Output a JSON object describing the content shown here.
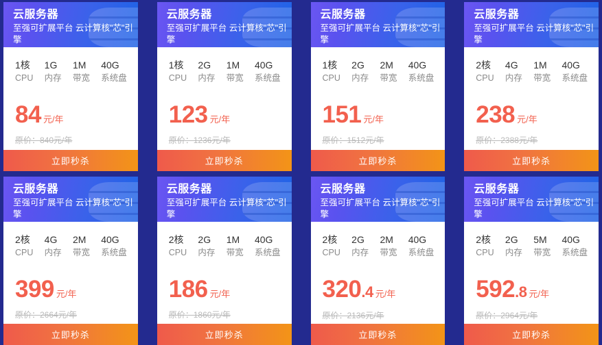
{
  "theme": {
    "page_background": "#232a8f",
    "header_gradient_from": "#6a56f2",
    "header_gradient_to": "#1f63e6",
    "price_color": "#f2604e",
    "button_gradient_from": "#ef5a4b",
    "button_gradient_to": "#f39417"
  },
  "common": {
    "title": "云服务器",
    "subtitle": "至强可扩展平台 云计算核\"芯\"引擎",
    "buy_label": "立即秒杀",
    "spec_labels": [
      "CPU",
      "内存",
      "带宽",
      "系统盘"
    ]
  },
  "cards": [
    {
      "title": "云服务器",
      "subtitle": "至强可扩展平台 云计算核\"芯\"引擎",
      "specs": [
        {
          "value": "1核",
          "label": "CPU"
        },
        {
          "value": "1G",
          "label": "内存"
        },
        {
          "value": "1M",
          "label": "带宽"
        },
        {
          "value": "40G",
          "label": "系统盘"
        }
      ],
      "price_main": "84",
      "price_dec": "",
      "price_unit": "元/年",
      "orig_price": "原价：840元/年",
      "buy_label": "立即秒杀"
    },
    {
      "title": "云服务器",
      "subtitle": "至强可扩展平台 云计算核\"芯\"引擎",
      "specs": [
        {
          "value": "1核",
          "label": "CPU"
        },
        {
          "value": "2G",
          "label": "内存"
        },
        {
          "value": "1M",
          "label": "带宽"
        },
        {
          "value": "40G",
          "label": "系统盘"
        }
      ],
      "price_main": "123",
      "price_dec": "",
      "price_unit": "元/年",
      "orig_price": "原价：1236元/年",
      "buy_label": "立即秒杀"
    },
    {
      "title": "云服务器",
      "subtitle": "至强可扩展平台 云计算核\"芯\"引擎",
      "specs": [
        {
          "value": "1核",
          "label": "CPU"
        },
        {
          "value": "2G",
          "label": "内存"
        },
        {
          "value": "2M",
          "label": "带宽"
        },
        {
          "value": "40G",
          "label": "系统盘"
        }
      ],
      "price_main": "151",
      "price_dec": "",
      "price_unit": "元/年",
      "orig_price": "原价：1512元/年",
      "buy_label": "立即秒杀"
    },
    {
      "title": "云服务器",
      "subtitle": "至强可扩展平台 云计算核\"芯\"引擎",
      "specs": [
        {
          "value": "2核",
          "label": "CPU"
        },
        {
          "value": "4G",
          "label": "内存"
        },
        {
          "value": "1M",
          "label": "带宽"
        },
        {
          "value": "40G",
          "label": "系统盘"
        }
      ],
      "price_main": "238",
      "price_dec": "",
      "price_unit": "元/年",
      "orig_price": "原价：2388元/年",
      "buy_label": "立即秒杀"
    },
    {
      "title": "云服务器",
      "subtitle": "至强可扩展平台 云计算核\"芯\"引擎",
      "specs": [
        {
          "value": "2核",
          "label": "CPU"
        },
        {
          "value": "4G",
          "label": "内存"
        },
        {
          "value": "2M",
          "label": "带宽"
        },
        {
          "value": "40G",
          "label": "系统盘"
        }
      ],
      "price_main": "399",
      "price_dec": "",
      "price_unit": "元/年",
      "orig_price": "原价：2664元/年",
      "buy_label": "立即秒杀"
    },
    {
      "title": "云服务器",
      "subtitle": "至强可扩展平台 云计算核\"芯\"引擎",
      "specs": [
        {
          "value": "2核",
          "label": "CPU"
        },
        {
          "value": "2G",
          "label": "内存"
        },
        {
          "value": "1M",
          "label": "带宽"
        },
        {
          "value": "40G",
          "label": "系统盘"
        }
      ],
      "price_main": "186",
      "price_dec": "",
      "price_unit": "元/年",
      "orig_price": "原价：1860元/年",
      "buy_label": "立即秒杀"
    },
    {
      "title": "云服务器",
      "subtitle": "至强可扩展平台 云计算核\"芯\"引擎",
      "specs": [
        {
          "value": "2核",
          "label": "CPU"
        },
        {
          "value": "2G",
          "label": "内存"
        },
        {
          "value": "2M",
          "label": "带宽"
        },
        {
          "value": "40G",
          "label": "系统盘"
        }
      ],
      "price_main": "320",
      "price_dec": ".4",
      "price_unit": "元/年",
      "orig_price": "原价：2136元/年",
      "buy_label": "立即秒杀"
    },
    {
      "title": "云服务器",
      "subtitle": "至强可扩展平台 云计算核\"芯\"引擎",
      "specs": [
        {
          "value": "2核",
          "label": "CPU"
        },
        {
          "value": "2G",
          "label": "内存"
        },
        {
          "value": "5M",
          "label": "带宽"
        },
        {
          "value": "40G",
          "label": "系统盘"
        }
      ],
      "price_main": "592",
      "price_dec": ".8",
      "price_unit": "元/年",
      "orig_price": "原价：2964元/年",
      "buy_label": "立即秒杀"
    }
  ]
}
